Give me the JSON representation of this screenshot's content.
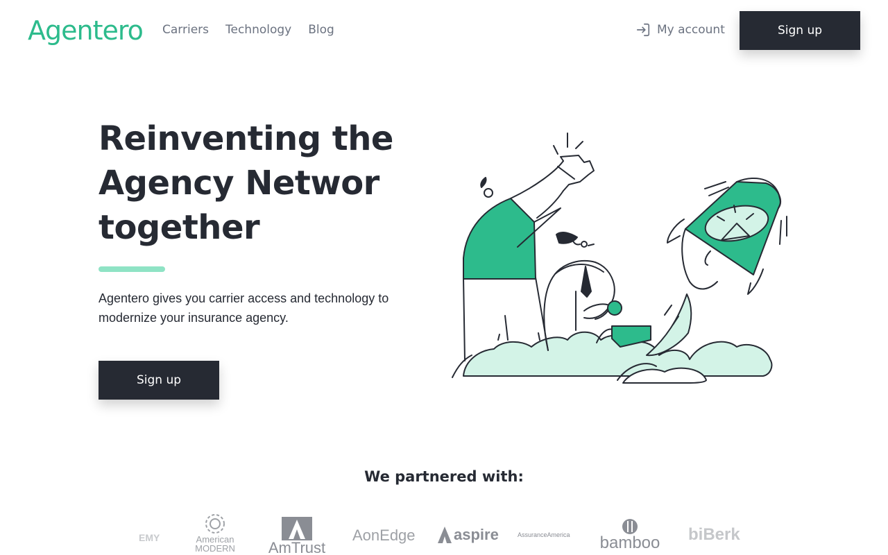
{
  "header": {
    "logo": "Agentero",
    "nav": [
      "Carriers",
      "Technology",
      "Blog"
    ],
    "account_label": "My account",
    "signup_label": "Sign up"
  },
  "hero": {
    "title_lines": [
      "Reinventing the",
      "Agency Networ",
      "together"
    ],
    "subtitle": "Agentero gives you carrier access and technology to modernize your insurance agency.",
    "signup_label": "Sign up"
  },
  "partners": {
    "title": "We partnered with:",
    "logos": [
      "EMY",
      "American MODERN",
      "AmTrust",
      "AonEdge",
      "aspire",
      "AssuranceAmerica",
      "bamboo",
      "biBerk"
    ]
  },
  "colors": {
    "brand_green": "#2dbb8c",
    "mint": "#d3f3e7",
    "accent_bar": "#8fe3c5",
    "dark": "#262a33",
    "muted_text": "#6b7280"
  },
  "icons": [
    "login-arrow-icon"
  ]
}
